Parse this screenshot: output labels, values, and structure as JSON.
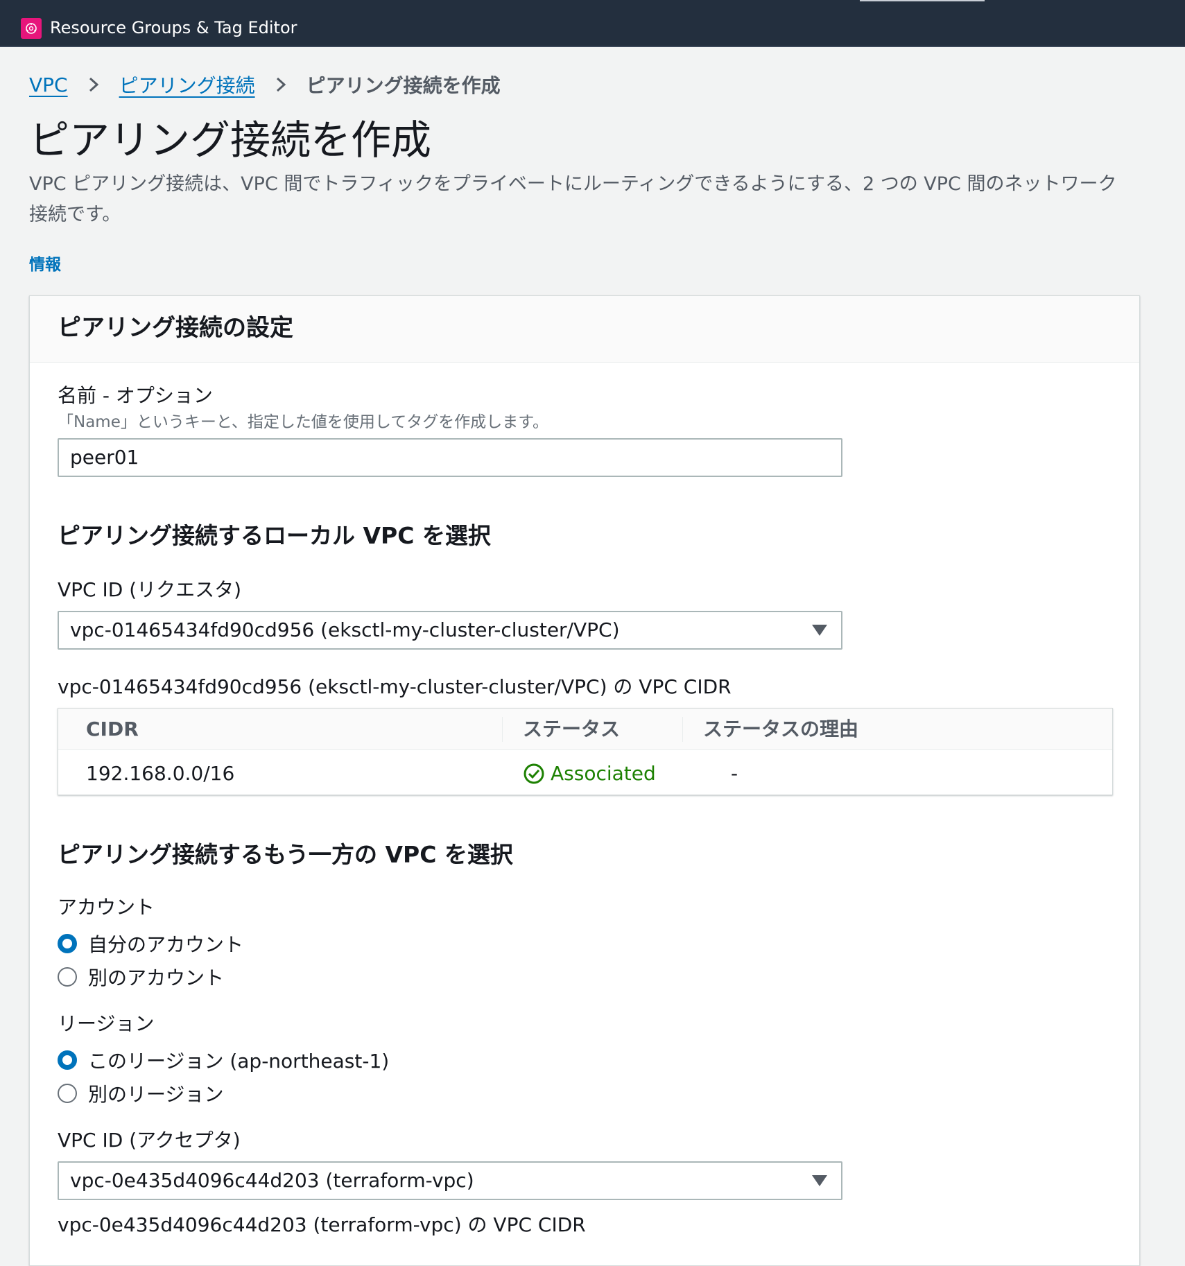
{
  "app": {
    "title": "Resource Groups & Tag Editor",
    "icon": "resource-groups-icon",
    "accent_color": "#e7157b"
  },
  "breadcrumb": {
    "items": [
      "VPC",
      "ピアリング接続"
    ],
    "current": "ピアリング接続を作成"
  },
  "page": {
    "title": "ピアリング接続を作成",
    "description": "VPC ピアリング接続は、VPC 間でトラフィックをプライベートにルーティングできるようにする、2 つの VPC 間のネットワーク接続です。",
    "info_link": "情報"
  },
  "panel": {
    "title": "ピアリング接続の設定",
    "name_field": {
      "label": "名前 - オプション",
      "description": "「Name」というキーと、指定した値を使用してタグを作成します。",
      "value": "peer01"
    },
    "local_vpc": {
      "heading": "ピアリング接続するローカル VPC を選択",
      "label": "VPC ID (リクエスタ)",
      "selected": "vpc-01465434fd90cd956 (eksctl-my-cluster-cluster/VPC)",
      "cidr_caption": "vpc-01465434fd90cd956 (eksctl-my-cluster-cluster/VPC) の VPC CIDR",
      "table": {
        "columns": [
          "CIDR",
          "ステータス",
          "ステータスの理由"
        ],
        "rows": [
          {
            "cidr": "192.168.0.0/16",
            "status": "Associated",
            "reason": "-"
          }
        ]
      }
    },
    "peer_vpc": {
      "heading": "ピアリング接続するもう一方の VPC を選択",
      "account": {
        "label": "アカウント",
        "options": [
          "自分のアカウント",
          "別のアカウント"
        ],
        "selected_index": 0
      },
      "region": {
        "label": "リージョン",
        "options": [
          "このリージョン (ap-northeast-1)",
          "別のリージョン"
        ],
        "selected_index": 0
      },
      "label": "VPC ID (アクセプタ)",
      "selected": "vpc-0e435d4096c44d203 (terraform-vpc)",
      "cidr_caption": "vpc-0e435d4096c44d203 (terraform-vpc) の VPC CIDR"
    }
  },
  "colors": {
    "link": "#0073bb",
    "status_ok": "#1d8102",
    "topbar": "#232f3e"
  }
}
